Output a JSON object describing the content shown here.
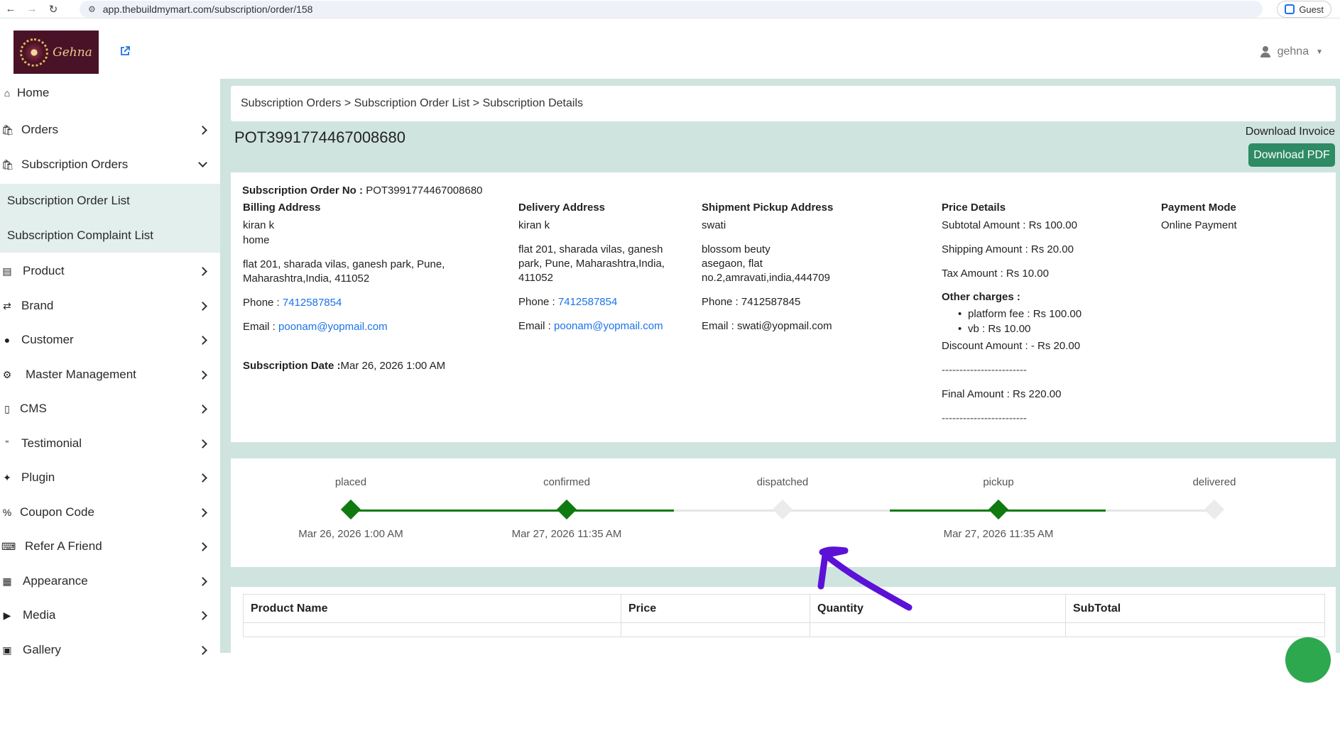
{
  "browser": {
    "url": "app.thebuildmymart.com/subscription/order/158",
    "profile_label": "Guest"
  },
  "header": {
    "logo_text": "Gehna",
    "user_name": "gehna"
  },
  "sidebar": {
    "items": [
      {
        "label": "Home",
        "icon": "home-icon"
      },
      {
        "label": "Orders",
        "icon": "bag-icon"
      },
      {
        "label": "Subscription Orders",
        "icon": "bag-icon"
      },
      {
        "label": "Product",
        "icon": "archive-icon"
      },
      {
        "label": "Brand",
        "icon": "shuffle-icon"
      },
      {
        "label": "Customer",
        "icon": "user-icon"
      },
      {
        "label": "Master Management",
        "icon": "user-cog-icon"
      },
      {
        "label": "CMS",
        "icon": "file-icon"
      },
      {
        "label": "Testimonial",
        "icon": "quote-icon"
      },
      {
        "label": "Plugin",
        "icon": "puzzle-icon"
      },
      {
        "label": "Coupon Code",
        "icon": "percent-icon"
      },
      {
        "label": "Refer A Friend",
        "icon": "keyboard-icon"
      },
      {
        "label": "Appearance",
        "icon": "image-icon"
      },
      {
        "label": "Media",
        "icon": "play-icon"
      },
      {
        "label": "Gallery",
        "icon": "gallery-icon"
      }
    ],
    "subitems": [
      {
        "label": "Subscription Order List"
      },
      {
        "label": "Subscription Complaint List"
      }
    ]
  },
  "breadcrumb": "Subscription Orders > Subscription Order List > Subscription Details",
  "order": {
    "id": "POT3991774467008680",
    "download_invoice_label": "Download Invoice",
    "download_pdf_label": "Download PDF",
    "order_no_label": "Subscription Order No :",
    "order_no": "POT3991774467008680",
    "subscription_date_label": "Subscription Date :",
    "subscription_date": "Mar 26, 2026 1:00 AM"
  },
  "billing": {
    "title": "Billing Address",
    "name": "kiran k",
    "type": "home",
    "address_line1": "flat 201, sharada vilas, ganesh park, Pune,",
    "address_line2": "Maharashtra,India, 411052",
    "phone_label": "Phone :",
    "phone": "7412587854",
    "email_label": "Email :",
    "email": "poonam@yopmail.com"
  },
  "delivery": {
    "title": "Delivery Address",
    "name": "kiran k",
    "address_line1": "flat 201, sharada vilas, ganesh",
    "address_line2": "park, Pune, Maharashtra,India,",
    "address_line3": "411052",
    "phone_label": "Phone :",
    "phone": "7412587854",
    "email_label": "Email :",
    "email": "poonam@yopmail.com"
  },
  "pickup": {
    "title": "Shipment Pickup Address",
    "name": "swati",
    "address_line1": "blossom beuty",
    "address_line2": "asegaon, flat",
    "address_line3": "no.2,amravati,india,444709",
    "phone": "Phone : 7412587845",
    "email": "Email : swati@yopmail.com"
  },
  "price": {
    "title": "Price Details",
    "subtotal": "Subtotal Amount : Rs 100.00",
    "shipping": "Shipping Amount : Rs 20.00",
    "tax": "Tax Amount : Rs 10.00",
    "other_label": "Other charges :",
    "other": [
      {
        "text": "platform fee :  Rs  100.00"
      },
      {
        "text": "vb :  Rs  10.00"
      }
    ],
    "discount": "Discount Amount : - Rs 20.00",
    "divider": "------------------------",
    "final": "Final Amount : Rs  220.00"
  },
  "payment": {
    "title": "Payment Mode",
    "mode": "Online Payment"
  },
  "tracker": {
    "steps": [
      {
        "label": "placed",
        "date": "Mar 26, 2026 1:00 AM",
        "done": true
      },
      {
        "label": "confirmed",
        "date": "Mar 27, 2026 11:35 AM",
        "done": true
      },
      {
        "label": "dispatched",
        "date": "",
        "done": false
      },
      {
        "label": "pickup",
        "date": "Mar 27, 2026 11:35 AM",
        "done": true
      },
      {
        "label": "delivered",
        "date": "",
        "done": false
      }
    ],
    "done_color": "#0f7a0f",
    "pending_color": "#e6e6e6"
  },
  "table": {
    "headers": [
      "Product Name",
      "Price",
      "Quantity",
      "SubTotal"
    ]
  },
  "colors": {
    "accent_green": "#2e8b63",
    "background": "#cfe4df",
    "link": "#1a73e8",
    "annotation_arrow": "#5b12d6"
  }
}
